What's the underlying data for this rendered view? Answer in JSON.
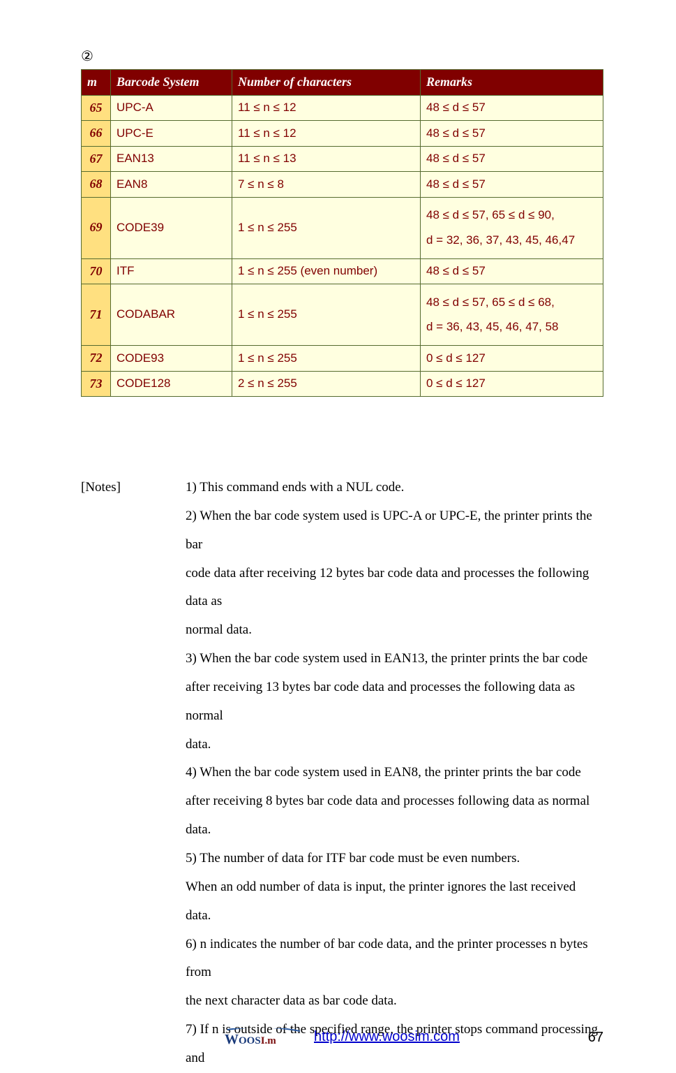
{
  "circled_marker": "②",
  "table": {
    "headers": {
      "m": "m",
      "system": "Barcode System",
      "numchars": "Number of characters",
      "remarks": "Remarks"
    },
    "rows": [
      {
        "m": "65",
        "system": "UPC-A",
        "numchars": "11 ≤ n ≤ 12",
        "remarks": "48 ≤ d ≤ 57"
      },
      {
        "m": "66",
        "system": "UPC-E",
        "numchars": "11 ≤ n ≤ 12",
        "remarks": "48 ≤ d ≤ 57"
      },
      {
        "m": "67",
        "system": "EAN13",
        "numchars": "11 ≤ n ≤ 13",
        "remarks": "48 ≤ d ≤ 57"
      },
      {
        "m": "68",
        "system": "EAN8",
        "numchars": "7 ≤ n ≤ 8",
        "remarks": "48 ≤ d ≤ 57"
      },
      {
        "m": "69",
        "system": "CODE39",
        "numchars": "1 ≤ n ≤ 255",
        "remarks_l1": "48 ≤ d ≤ 57, 65 ≤ d ≤ 90,",
        "remarks_l2": "d = 32, 36, 37, 43, 45, 46,47"
      },
      {
        "m": "70",
        "system": "ITF",
        "numchars": "1 ≤ n ≤ 255 (even number)",
        "remarks": "48 ≤ d ≤ 57"
      },
      {
        "m": "71",
        "system": "CODABAR",
        "numchars": "1 ≤ n ≤ 255",
        "remarks_l1": "48 ≤ d ≤ 57, 65 ≤ d ≤ 68,",
        "remarks_l2": "d = 36, 43, 45, 46, 47, 58"
      },
      {
        "m": "72",
        "system": "CODE93",
        "numchars": "1 ≤ n ≤ 255",
        "remarks": "0 ≤ d ≤ 127"
      },
      {
        "m": "73",
        "system": "CODE128",
        "numchars": "2 ≤ n ≤ 255",
        "remarks": "0 ≤ d ≤ 127"
      }
    ]
  },
  "notes": {
    "label": "[Notes]",
    "n1": "1) This command ends with a NUL code.",
    "n2a": "2) When the bar code system used is UPC-A or UPC-E, the printer prints the bar",
    "n2b": "code data after receiving 12 bytes bar code data and processes the following data as",
    "n2c": "normal data.",
    "n3a": "3) When the bar code system used in EAN13, the printer prints the bar code",
    "n3b": "after receiving 13 bytes bar code data and processes the following data as normal",
    "n3c": "data.",
    "n4a": "4) When the bar code system used in EAN8, the printer prints the bar code",
    "n4b": "after receiving 8 bytes bar code data and processes following data as normal data.",
    "n5": "5) The number of data for ITF bar code must be even numbers.",
    "n5b": "When an odd number of data is input, the printer ignores the last received data.",
    "n6a": "6) n indicates the number of bar code data, and the printer processes n bytes from",
    "n6b": "the next character data as bar code data.",
    "n7": "7) If n is outside of the specified range, the printer stops command processing and"
  },
  "footer": {
    "logo_text_w": "W",
    "logo_text_rest": "OOS",
    "logo_text_suffix": "I.m",
    "link": "http://www.woosim.com",
    "page_number": "67"
  }
}
